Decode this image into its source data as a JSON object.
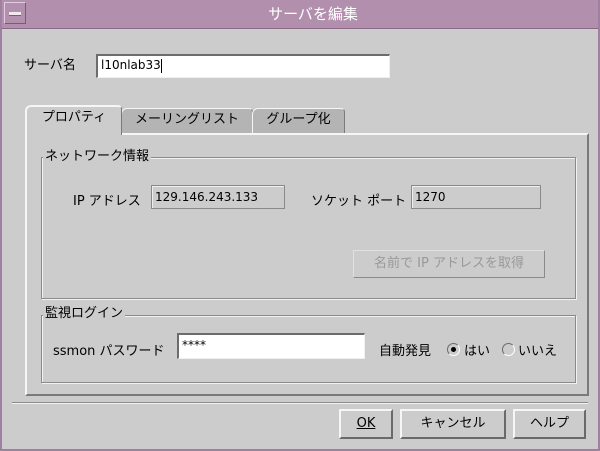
{
  "window": {
    "title": "サーバを編集"
  },
  "server": {
    "label": "サーバ名",
    "value": "l10nlab33"
  },
  "tabs": [
    {
      "label": "プロパティ",
      "active": true
    },
    {
      "label": "メーリングリスト",
      "active": false
    },
    {
      "label": "グループ化",
      "active": false
    }
  ],
  "network": {
    "title": "ネットワーク情報",
    "ip_label": "IP アドレス",
    "ip_value": "129.146.243.133",
    "port_label": "ソケット ポート",
    "port_value": "1270",
    "get_ip_button": "名前で IP アドレスを取得"
  },
  "monitor": {
    "title": "監視ログイン",
    "password_label": "ssmon パスワード",
    "password_value": "****",
    "auto_detect_label": "自動発見",
    "yes_label": "はい",
    "no_label": "いいえ",
    "selected": "はい"
  },
  "buttons": {
    "ok": "OK",
    "cancel": "キャンセル",
    "help": "ヘルプ"
  }
}
